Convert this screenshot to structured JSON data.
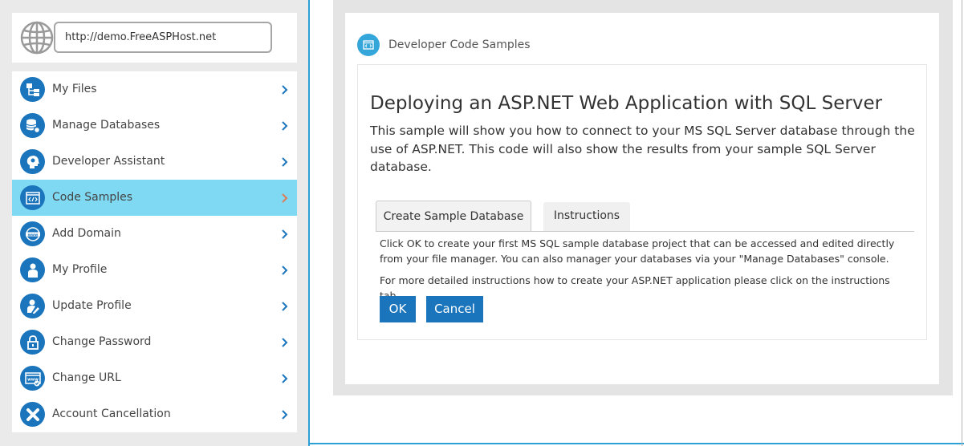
{
  "url_bar": {
    "value": "http://demo.FreeASPHost.net"
  },
  "menu": {
    "items": [
      {
        "label": "My Files",
        "icon": "folder-tree-icon",
        "active": false
      },
      {
        "label": "Manage Databases",
        "icon": "database-gear-icon",
        "active": false
      },
      {
        "label": "Developer Assistant",
        "icon": "head-gear-icon",
        "active": false
      },
      {
        "label": "Code Samples",
        "icon": "code-window-icon",
        "active": true
      },
      {
        "label": "Add Domain",
        "icon": "www-globe-icon",
        "active": false
      },
      {
        "label": "My Profile",
        "icon": "person-icon",
        "active": false
      },
      {
        "label": "Update Profile",
        "icon": "person-edit-icon",
        "active": false
      },
      {
        "label": "Change Password",
        "icon": "lock-icon",
        "active": false
      },
      {
        "label": "Change URL",
        "icon": "www-window-icon",
        "active": false
      },
      {
        "label": "Account Cancellation",
        "icon": "close-x-icon",
        "active": false
      }
    ]
  },
  "content": {
    "header_title": "Developer Code Samples",
    "heading": "Deploying an ASP.NET Web Application with SQL Server",
    "description": "This sample will show you how to connect to your MS SQL Server database through the use of ASP.NET. This code will also show the results from your sample SQL Server database.",
    "tabs": [
      {
        "label": "Create Sample Database",
        "active": true
      },
      {
        "label": "Instructions",
        "active": false
      }
    ],
    "info_1": "Click OK to create your first MS SQL sample database project that can be accessed and edited directly from your file manager. You can also manager your databases via your \"Manage Databases\" console.",
    "info_2": "For more detailed instructions how to create your ASP.NET application please click on the instructions tab.",
    "ok_label": "OK",
    "cancel_label": "Cancel"
  },
  "colors": {
    "accent_blue": "#1b75bc",
    "active_item_bg": "#7fd9f2",
    "active_chevron": "#e07b53",
    "chevron": "#1b75bc"
  }
}
